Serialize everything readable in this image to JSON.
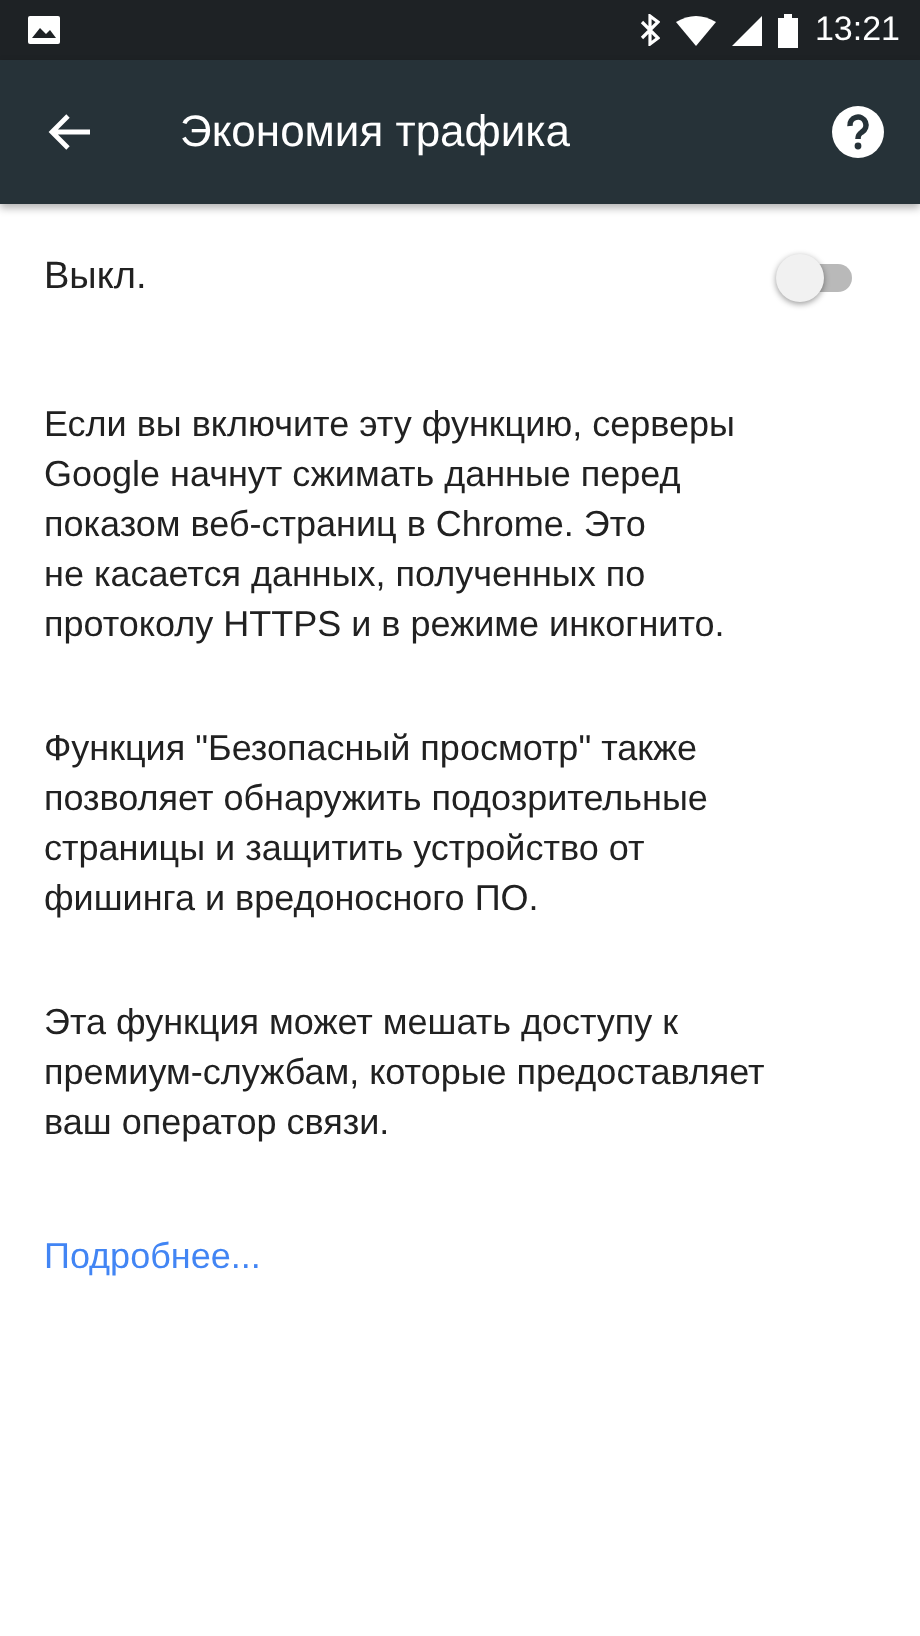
{
  "status_bar": {
    "time": "13:21"
  },
  "toolbar": {
    "title": "Экономия трафика"
  },
  "setting": {
    "label": "Выкл.",
    "on": false
  },
  "paragraphs": [
    "Если вы включите эту функцию, серверы\nGoogle начнут сжимать данные перед\nпоказом веб-страниц в Chrome. Это\nне касается данных, полученных по\nпротоколу HTTPS и в режиме инкогнито.",
    "Функция \"Безопасный просмотр\" также\nпозволяет обнаружить подозрительные\nстраницы и защитить устройство от\nфишинга и вредоносного ПО.",
    "Эта функция может мешать доступу к\nпремиум-службам, которые предоставляет\nваш оператор связи."
  ],
  "link": "Подробнее..."
}
